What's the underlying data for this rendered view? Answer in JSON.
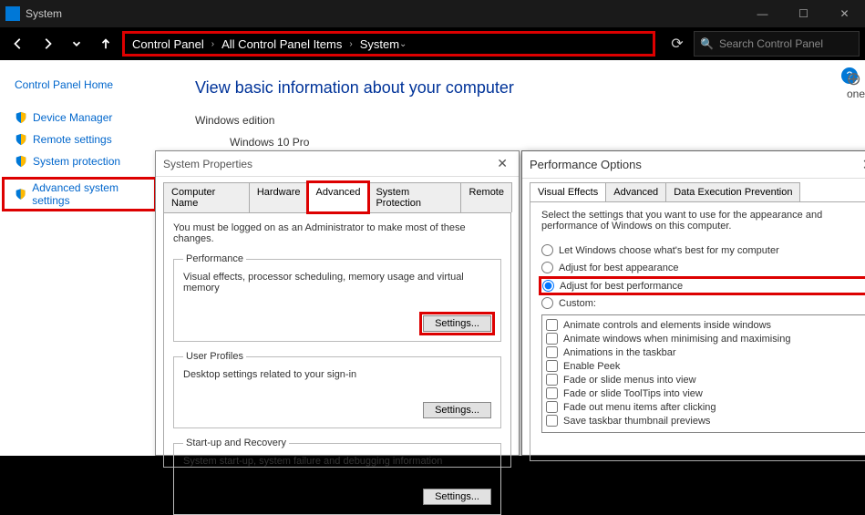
{
  "titlebar": {
    "title": "System"
  },
  "nav": {
    "breadcrumb": [
      "Control Panel",
      "All Control Panel Items",
      "System"
    ],
    "search_placeholder": "Search Control Panel"
  },
  "sidebar": {
    "home": "Control Panel Home",
    "links": [
      {
        "label": "Device Manager"
      },
      {
        "label": "Remote settings"
      },
      {
        "label": "System protection"
      },
      {
        "label": "Advanced system settings",
        "highlighted": true
      }
    ]
  },
  "main": {
    "heading": "View basic information about your computer",
    "edition_label": "Windows edition",
    "edition_value": "Windows 10 Pro",
    "partial_text": "one"
  },
  "sysprops": {
    "title": "System Properties",
    "tabs": [
      "Computer Name",
      "Hardware",
      "Advanced",
      "System Protection",
      "Remote"
    ],
    "active_tab": "Advanced",
    "note": "You must be logged on as an Administrator to make most of these changes.",
    "groups": [
      {
        "legend": "Performance",
        "desc": "Visual effects, processor scheduling, memory usage and virtual memory",
        "button": "Settings...",
        "hl": true
      },
      {
        "legend": "User Profiles",
        "desc": "Desktop settings related to your sign-in",
        "button": "Settings..."
      },
      {
        "legend": "Start-up and Recovery",
        "desc": "System start-up, system failure and debugging information",
        "button": "Settings..."
      }
    ]
  },
  "perf": {
    "title": "Performance Options",
    "tabs": [
      "Visual Effects",
      "Advanced",
      "Data Execution Prevention"
    ],
    "active_tab": "Visual Effects",
    "intro": "Select the settings that you want to use for the appearance and performance of Windows on this computer.",
    "radios": [
      {
        "label": "Let Windows choose what's best for my computer",
        "checked": false
      },
      {
        "label": "Adjust for best appearance",
        "checked": false
      },
      {
        "label": "Adjust for best performance",
        "checked": true,
        "hl": true
      },
      {
        "label": "Custom:",
        "checked": false
      }
    ],
    "checks": [
      "Animate controls and elements inside windows",
      "Animate windows when minimising and maximising",
      "Animations in the taskbar",
      "Enable Peek",
      "Fade or slide menus into view",
      "Fade or slide ToolTips into view",
      "Fade out menu items after clicking",
      "Save taskbar thumbnail previews"
    ]
  }
}
